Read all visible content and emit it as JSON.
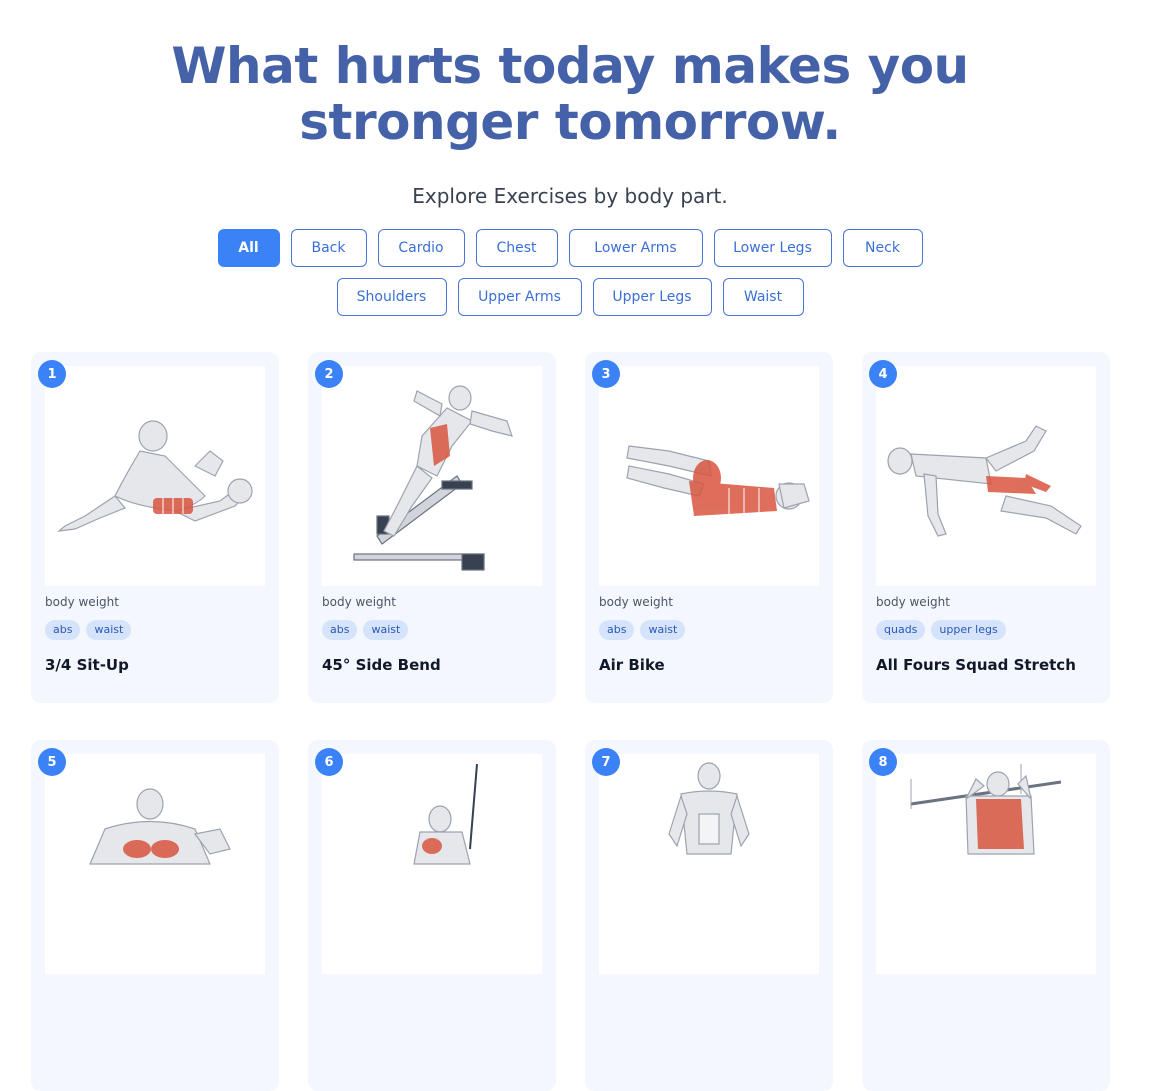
{
  "hero": {
    "title_line1": "What hurts today makes you",
    "title_line2": "stronger tomorrow.",
    "subtitle": "Explore Exercises by body part."
  },
  "filters": {
    "row1": [
      "All",
      "Back",
      "Cardio",
      "Chest",
      "Lower Arms",
      "Lower Legs",
      "Neck"
    ],
    "row2": [
      "Shoulders",
      "Upper Arms",
      "Upper Legs",
      "Waist"
    ],
    "active": "All"
  },
  "exercises": [
    {
      "num": "1",
      "equipment": "body weight",
      "tags": [
        "abs",
        "waist"
      ],
      "name": "3/4 Sit-Up"
    },
    {
      "num": "2",
      "equipment": "body weight",
      "tags": [
        "abs",
        "waist"
      ],
      "name": "45° Side Bend"
    },
    {
      "num": "3",
      "equipment": "body weight",
      "tags": [
        "abs",
        "waist"
      ],
      "name": "Air Bike"
    },
    {
      "num": "4",
      "equipment": "body weight",
      "tags": [
        "quads",
        "upper legs"
      ],
      "name": "All Fours Squad Stretch"
    },
    {
      "num": "5"
    },
    {
      "num": "6"
    },
    {
      "num": "7"
    },
    {
      "num": "8"
    }
  ],
  "colors": {
    "accent": "#3b82f6",
    "title": "#4561a8",
    "card_bg": "#f4f7fe",
    "tag_bg": "#d6e4fb",
    "muscle": "#d9553f"
  }
}
